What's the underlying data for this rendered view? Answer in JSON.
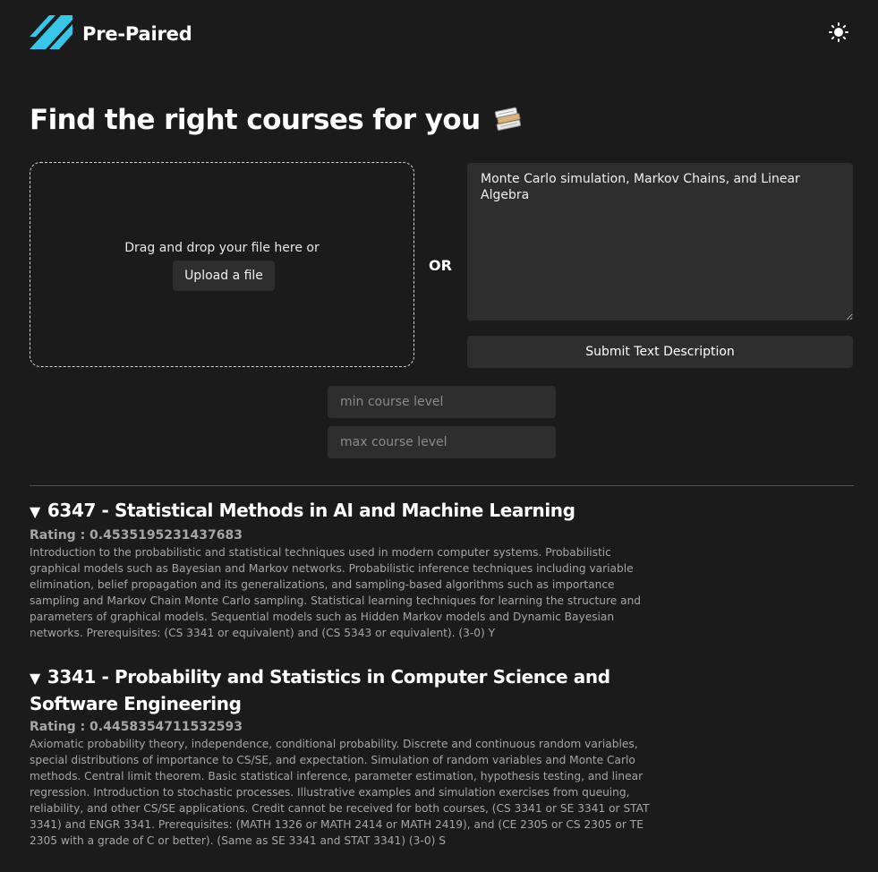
{
  "header": {
    "brand": "Pre-Paired",
    "logo_icon": "prepaired-logo-icon",
    "theme_icon": "sun-icon",
    "accent_color": "#35c6e8"
  },
  "main": {
    "title": "Find the right courses for you",
    "title_icon": "books-icon",
    "dropzone_text": "Drag and drop your file here or",
    "upload_label": "Upload a file",
    "or_label": "OR",
    "text_description": "Monte Carlo simulation, Markov Chains, and Linear Algebra",
    "submit_label": "Submit Text Description",
    "min_level_placeholder": "min course level",
    "max_level_placeholder": "max course level"
  },
  "results": [
    {
      "title": "6347 - Statistical Methods in AI and Machine Learning",
      "rating": "Rating : 0.4535195231437683",
      "description": "Introduction to the probabilistic and statistical techniques used in modern computer systems. Probabilistic graphical models such as Bayesian and Markov networks. Probabilistic inference techniques including variable elimination, belief propagation and its generalizations, and sampling-based algorithms such as importance sampling and Markov Chain Monte Carlo sampling. Statistical learning techniques for learning the structure and parameters of graphical models. Sequential models such as Hidden Markov models and Dynamic Bayesian networks. Prerequisites: (CS 3341 or equivalent) and (CS 5343 or equivalent). (3-0) Y"
    },
    {
      "title": "3341 - Probability and Statistics in Computer Science and Software Engineering",
      "rating": "Rating : 0.4458354711532593",
      "description": "Axiomatic probability theory, independence, conditional probability. Discrete and continuous random variables, special distributions of importance to CS/SE, and expectation. Simulation of random variables and Monte Carlo methods. Central limit theorem. Basic statistical inference, parameter estimation, hypothesis testing, and linear regression. Introduction to stochastic processes. Illustrative examples and simulation exercises from queuing, reliability, and other CS/SE applications. Credit cannot be received for both courses, (CS 3341 or SE 3341 or STAT 3341) and ENGR 3341. Prerequisites: (MATH 1326 or MATH 2414 or MATH 2419), and (CE 2305 or CS 2305 or TE 2305 with a grade of C or better). (Same as SE 3341 and STAT 3341) (3-0) S"
    }
  ]
}
